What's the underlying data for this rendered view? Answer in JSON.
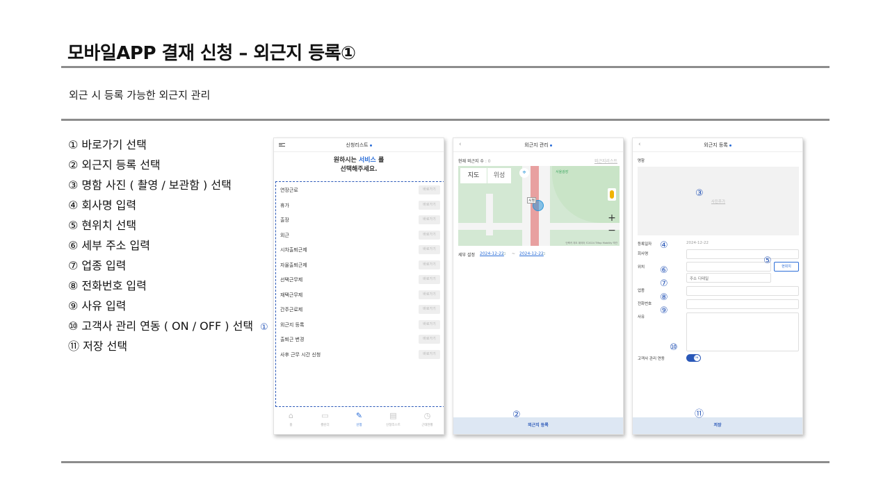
{
  "slide": {
    "title": "모바일APP 결재 신청 – 외근지 등록①",
    "subtitle": "외근 시 등록 가능한 외근지 관리",
    "steps": [
      "① 바로가기 선택",
      "② 외근지 등록 선택",
      "③ 명함 사진 ( 촬영 / 보관함 ) 선택",
      "④ 회사명 입력",
      "⑤ 현위치 선택",
      "⑥ 세부 주소 입력",
      "⑦ 업종 입력",
      "⑧ 전화번호 입력",
      "⑨ 사유 입력",
      "⑩ 고객사 관리 연동 ( ON / OFF ) 선택",
      "⑪ 저장 선택"
    ]
  },
  "screen1": {
    "header": "신청리스트",
    "greeting_prefix": "원하시는 ",
    "greeting_highlight": "서비스",
    "greeting_suffix": " 를",
    "greeting_line2": "선택해주세요.",
    "shortcut_label": "바로가기",
    "menu": [
      "연장근로",
      "휴가",
      "출장",
      "외근",
      "시차출퇴근제",
      "자율출퇴근제",
      "선택근무제",
      "재택근무제",
      "간주근로제",
      "외근지 등록",
      "출퇴근 변경",
      "사후 근무 시간 신청"
    ],
    "marker": "①",
    "tabs": [
      {
        "icon": "home-icon",
        "label": "홈"
      },
      {
        "icon": "calendar-icon",
        "label": "캘린더"
      },
      {
        "icon": "pencil-icon",
        "label": "신청"
      },
      {
        "icon": "document-icon",
        "label": "신청리스트"
      },
      {
        "icon": "clock-icon",
        "label": "근태현황"
      }
    ]
  },
  "screen2": {
    "header": "외근지 관리",
    "count_label": "현재 외근지 수",
    "count_value": ": 0",
    "list_link": "외근지리스트",
    "map_btn_map": "지도",
    "map_btn_satellite": "위성",
    "map_label_city": "서울광장",
    "pin_tag": "시청",
    "zoom_in": "+",
    "zoom_out": "−",
    "copyright": "단축키  지도 데이터 ©2024 TMap Mobility  약관",
    "period_label": "세부 설정",
    "date_start": "2024-12-22",
    "date_sep": "~",
    "date_end": "2024-12-22",
    "marker": "②",
    "bottom_button": "외근지 등록"
  },
  "screen3": {
    "header": "외근지 등록",
    "card_label": "명함",
    "photo_text": "사진추가",
    "reg_date_label": "등록일자",
    "reg_date": "2024-12-22",
    "company_label": "회사명",
    "location_label": "위치",
    "current_loc_btn": "현위치",
    "address_placeholder": "주소 디테일",
    "industry_label": "업종",
    "phone_label": "전화번호",
    "reason_label": "사유",
    "sync_label": "고객사 관리 연동",
    "toggle_text": "ON",
    "save_button": "저장",
    "markers": {
      "m3": "③",
      "m4": "④",
      "m5": "⑤",
      "m6": "⑥",
      "m7": "⑦",
      "m8": "⑧",
      "m9": "⑨",
      "m10": "⑩",
      "m11": "⑪"
    }
  },
  "colors": {
    "accent": "#2a6dd8",
    "marker": "#2a58b8",
    "divider": "#8c8c8c",
    "bottom_bar": "#dde7f3"
  }
}
